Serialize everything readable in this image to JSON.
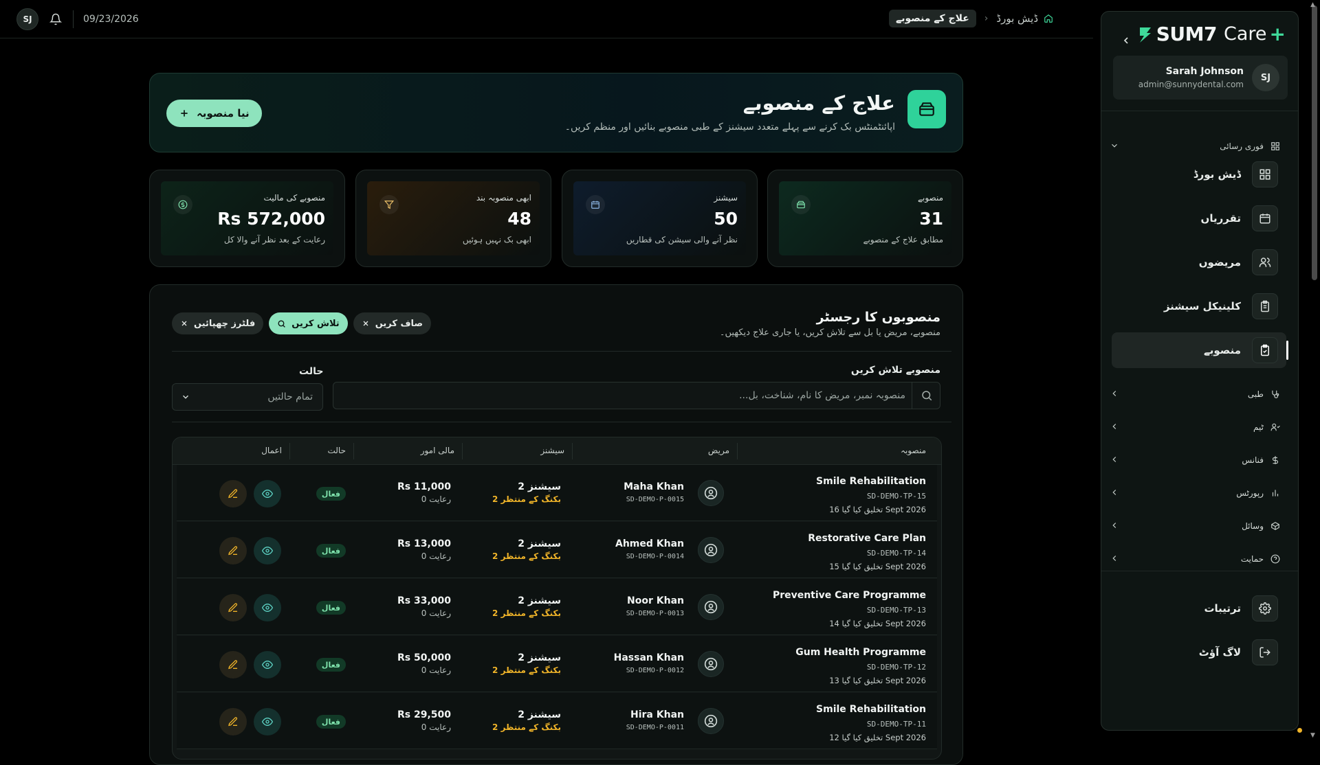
{
  "topbar": {
    "avatar_initials": "SJ",
    "date": "09/23/2026",
    "breadcrumb_home": "ڈیش بورڈ",
    "breadcrumb_current": "علاج کے منصوبے"
  },
  "sidebar": {
    "brand": "SUM7",
    "brand_care": "Care",
    "brand_plus": "+",
    "user": {
      "initials": "SJ",
      "name": "Sarah Johnson",
      "email": "admin@sunnydental.com"
    },
    "section_label": "فوری رسائی",
    "main_items": [
      {
        "label": "ڈیش بورڈ",
        "icon": "grid-icon"
      },
      {
        "label": "تقرریاں",
        "icon": "calendar-icon"
      },
      {
        "label": "مریضوں",
        "icon": "users-icon"
      },
      {
        "label": "کلینیکل سیشنز",
        "icon": "clipboard-icon"
      },
      {
        "label": "منصوبے",
        "icon": "clipboard-check-icon",
        "active": true
      }
    ],
    "groups": [
      {
        "label": "طبی",
        "icon": "stethoscope-icon"
      },
      {
        "label": "ٹیم",
        "icon": "team-icon"
      },
      {
        "label": "فنانس",
        "icon": "dollar-icon"
      },
      {
        "label": "رپورٹس",
        "icon": "bar-chart-icon"
      },
      {
        "label": "وسائل",
        "icon": "box-icon"
      },
      {
        "label": "حمایت",
        "icon": "help-icon"
      }
    ],
    "settings_label": "ترتیبات",
    "logout_label": "لاگ آؤٹ"
  },
  "hero": {
    "title": "علاج کے منصوبے",
    "subtitle": "اپائنٹمنٹس بک کرنے سے پہلے متعدد سیشنز کے طبی منصوبے بنائیں اور منظم کریں۔",
    "new_button": "نیا منصوبہ"
  },
  "stats": [
    {
      "label": "منصوبے",
      "value": "31",
      "sub": "مطابق علاج کے منصوبے",
      "icon": "box-icon",
      "tint": "#0d2a1f"
    },
    {
      "label": "سیشنز",
      "value": "50",
      "sub": "نظر آنے والی سیشن کی قطاریں",
      "icon": "calendar-icon",
      "tint": "#0e1c2c"
    },
    {
      "label": "ابھی منصوبہ بند",
      "value": "48",
      "sub": "ابھی بک نہیں ہوئیں",
      "icon": "filter-icon",
      "tint": "#2a1d0c"
    },
    {
      "label": "منصوبے کی مالیت",
      "value": "Rs 572,000",
      "sub": "رعایت کے بعد نظر آنے والا کل",
      "icon": "dollar-circle-icon",
      "tint": "#0d2319"
    }
  ],
  "register": {
    "title": "منصوبوں کا رجسٹر",
    "subtitle": "منصوبے، مریض یا بل سے تلاش کریں، یا جاری علاج دیکھیں۔",
    "chip_clear": "صاف کریں",
    "chip_search": "تلاش کریں",
    "chip_hide_filters": "فلٹرز چھپائیں",
    "search_label": "منصوبے تلاش کریں",
    "search_placeholder": "منصوبہ نمبر، مریض کا نام، شناخت، بل...",
    "status_label": "حالت",
    "status_value": "تمام حالتیں"
  },
  "table": {
    "headers": {
      "plan": "منصوبہ",
      "patient": "مریض",
      "sessions": "سیشنز",
      "finance": "مالی امور",
      "status": "حالت",
      "actions": "اعمال"
    },
    "rows": [
      {
        "plan": "Smile Rehabilitation",
        "plan_id": "SD-DEMO-TP-15",
        "created": "تخلیق کیا گیا 16 Sept 2026",
        "patient": "Maha Khan",
        "patient_id": "SD-DEMO-P-0015",
        "sessions": "2 سیشنز",
        "pending": "2 بکنگ کے منتظر",
        "amount": "Rs 11,000",
        "discount": "رعایت 0",
        "status": "فعال"
      },
      {
        "plan": "Restorative Care Plan",
        "plan_id": "SD-DEMO-TP-14",
        "created": "تخلیق کیا گیا 15 Sept 2026",
        "patient": "Ahmed Khan",
        "patient_id": "SD-DEMO-P-0014",
        "sessions": "2 سیشنز",
        "pending": "2 بکنگ کے منتظر",
        "amount": "Rs 13,000",
        "discount": "رعایت 0",
        "status": "فعال"
      },
      {
        "plan": "Preventive Care Programme",
        "plan_id": "SD-DEMO-TP-13",
        "created": "تخلیق کیا گیا 14 Sept 2026",
        "patient": "Noor Khan",
        "patient_id": "SD-DEMO-P-0013",
        "sessions": "2 سیشنز",
        "pending": "2 بکنگ کے منتظر",
        "amount": "Rs 33,000",
        "discount": "رعایت 0",
        "status": "فعال"
      },
      {
        "plan": "Gum Health Programme",
        "plan_id": "SD-DEMO-TP-12",
        "created": "تخلیق کیا گیا 13 Sept 2026",
        "patient": "Hassan Khan",
        "patient_id": "SD-DEMO-P-0012",
        "sessions": "2 سیشنز",
        "pending": "2 بکنگ کے منتظر",
        "amount": "Rs 50,000",
        "discount": "رعایت 0",
        "status": "فعال"
      },
      {
        "plan": "Smile Rehabilitation",
        "plan_id": "SD-DEMO-TP-11",
        "created": "تخلیق کیا گیا 12 Sept 2026",
        "patient": "Hira Khan",
        "patient_id": "SD-DEMO-P-0011",
        "sessions": "2 سیشنز",
        "pending": "2 بکنگ کے منتظر",
        "amount": "Rs 29,500",
        "discount": "رعایت 0",
        "status": "فعال"
      }
    ]
  },
  "colors": {
    "accent": "#2fd29a",
    "accent_soft": "#8ee3bd",
    "pending": "#f0b429",
    "active_badge": "#7fe3ad"
  }
}
